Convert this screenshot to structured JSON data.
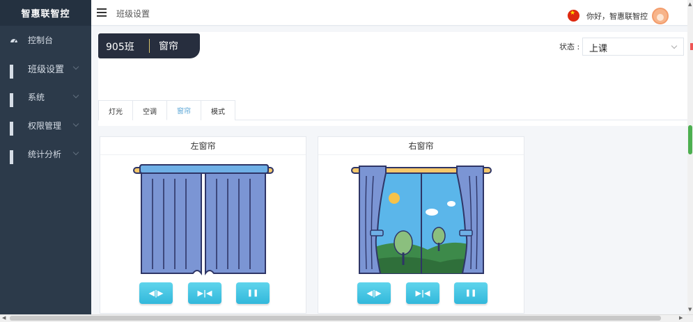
{
  "sidebar": {
    "brand": "智惠联智控",
    "items": [
      {
        "label": "控制台",
        "icon": "dashboard-icon"
      },
      {
        "label": "班级设置",
        "icon": "grid-icon"
      },
      {
        "label": "系统",
        "icon": "grid-icon"
      },
      {
        "label": "权限管理",
        "icon": "grid-icon"
      },
      {
        "label": "统计分析",
        "icon": "grid-icon"
      }
    ]
  },
  "header": {
    "breadcrumb": "班级设置",
    "greeting": "你好，智惠联智控",
    "flag_icon": "china-flag-icon",
    "avatar_icon": "user-avatar-icon"
  },
  "title_card": {
    "class_name": "905班",
    "device": "窗帘"
  },
  "status": {
    "label": "状态 :",
    "value": "上课"
  },
  "tabs": [
    {
      "label": "灯光",
      "active": false
    },
    {
      "label": "空调",
      "active": false
    },
    {
      "label": "窗帘",
      "active": true
    },
    {
      "label": "模式",
      "active": false
    }
  ],
  "curtains": {
    "left": {
      "title": "左窗帘",
      "state_illustration": "closed-curtain-icon",
      "buttons": [
        {
          "symbol": "◀|▶",
          "icon": "open-curtain-icon"
        },
        {
          "symbol": "▶|◀",
          "icon": "close-curtain-icon"
        },
        {
          "symbol": "❚❚",
          "icon": "pause-icon"
        }
      ]
    },
    "right": {
      "title": "右窗帘",
      "state_illustration": "open-curtain-window-icon",
      "buttons": [
        {
          "symbol": "◀|▶",
          "icon": "open-curtain-icon"
        },
        {
          "symbol": "▶|◀",
          "icon": "close-curtain-icon"
        },
        {
          "symbol": "❚❚",
          "icon": "pause-icon"
        }
      ]
    }
  },
  "colors": {
    "sidebar_bg": "#2c3a4a",
    "title_card_bg": "#272e3e",
    "accent": "#5aa6d6",
    "button": "#3cc0e0",
    "curtain": "#6f8fcf",
    "outline": "#2e3566"
  }
}
